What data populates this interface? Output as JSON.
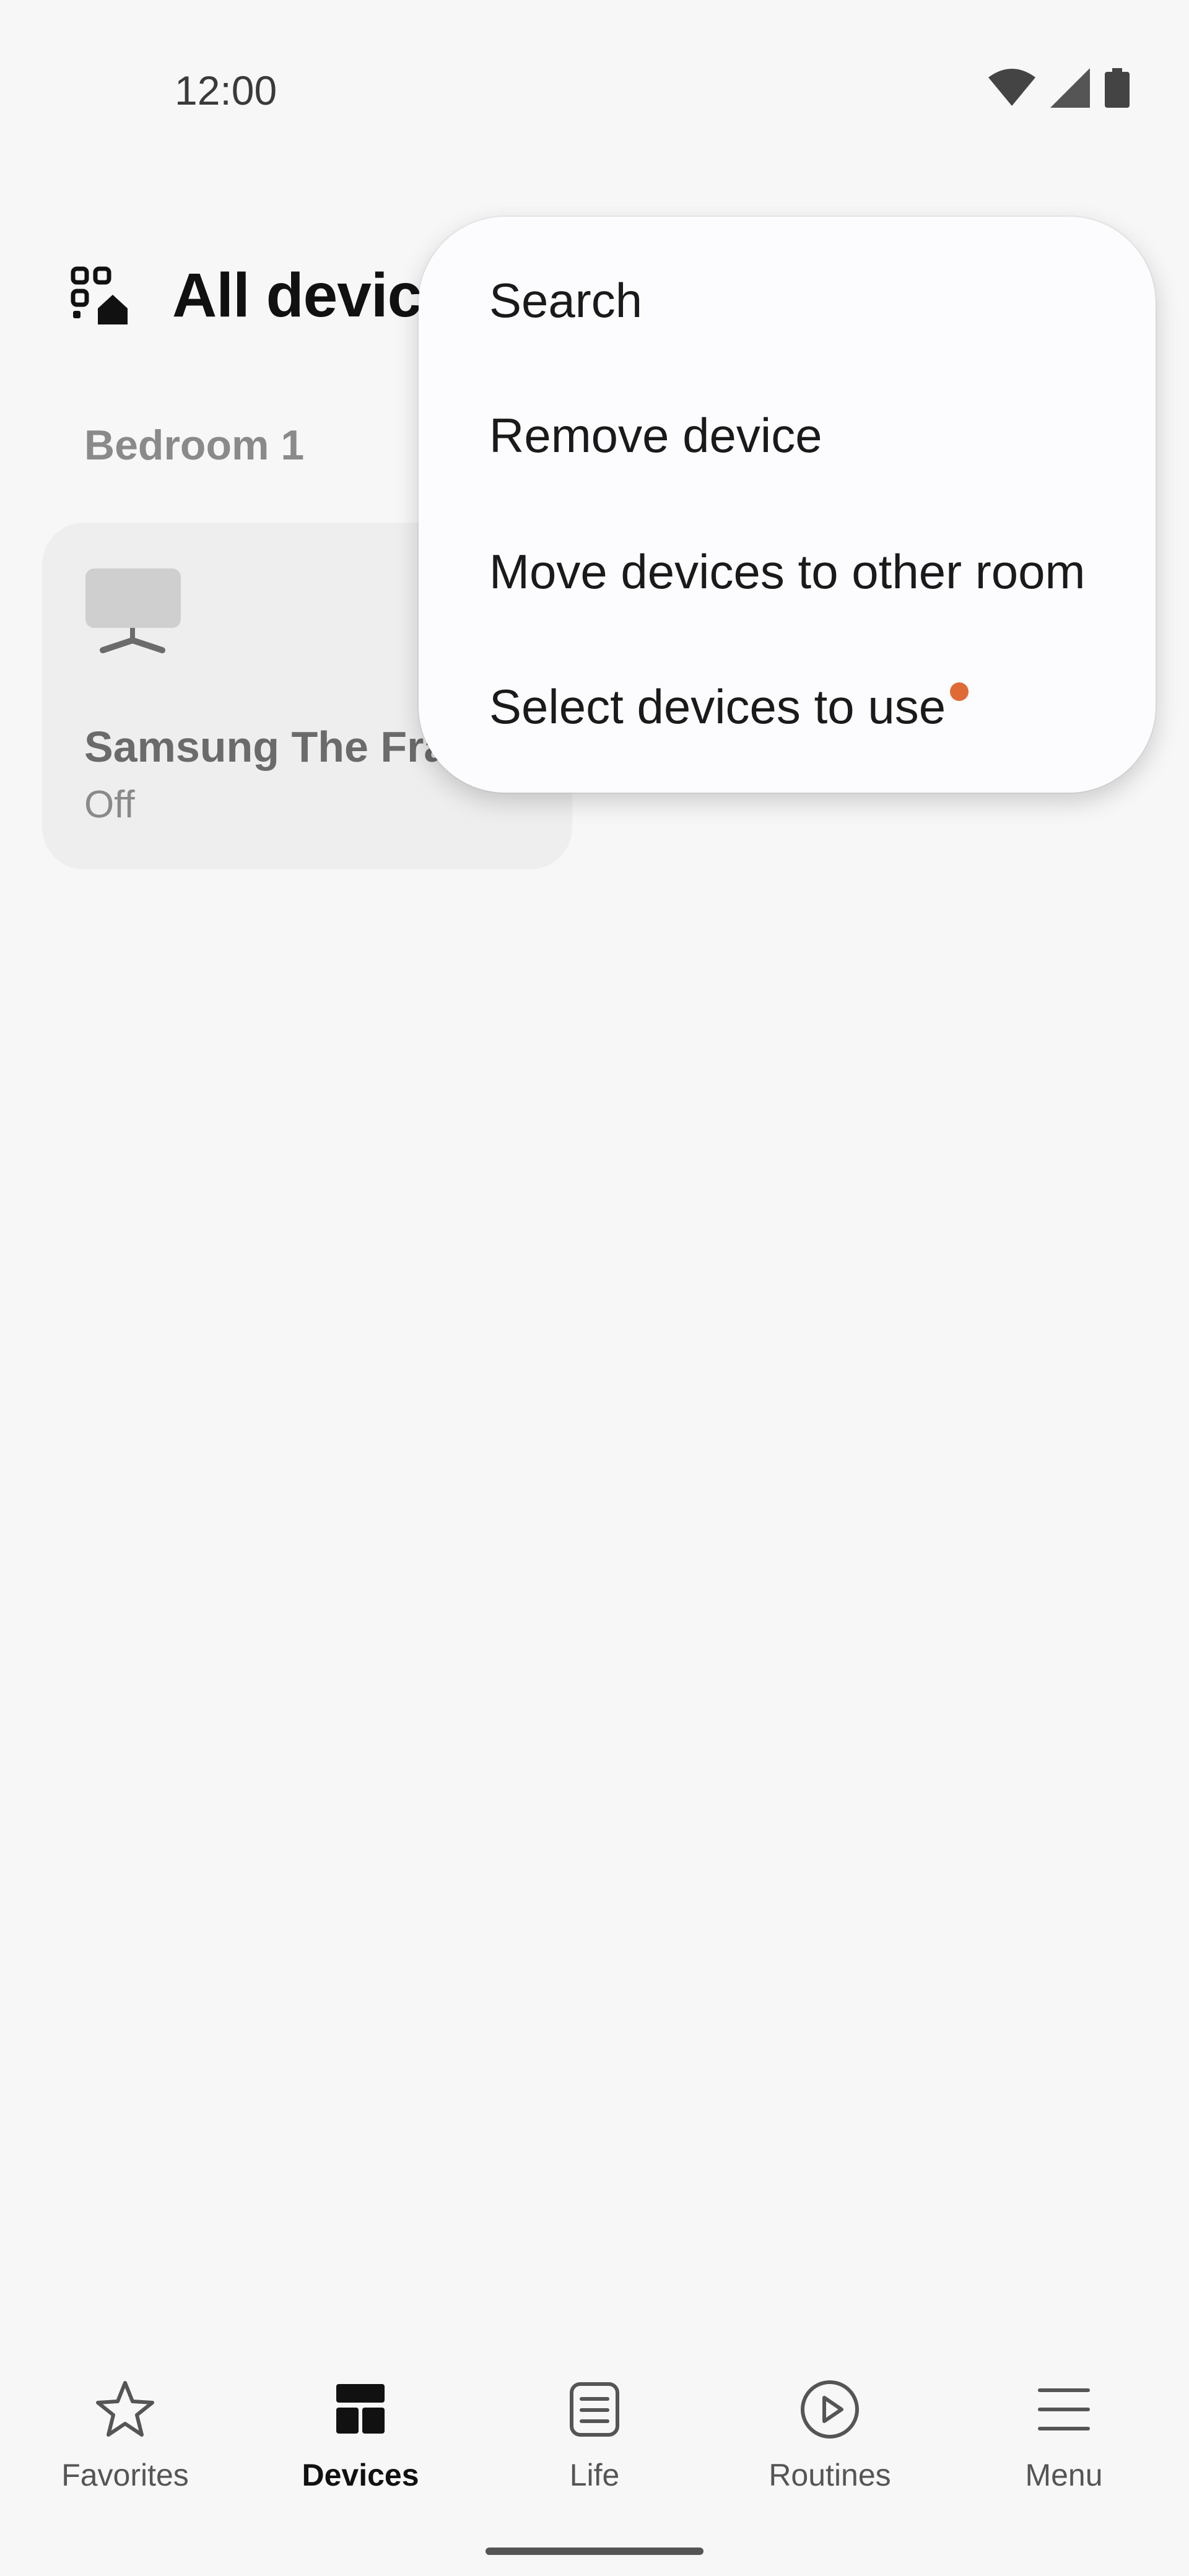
{
  "status_bar": {
    "time": "12:00"
  },
  "header": {
    "title": "All devic",
    "icon": "qr-home-icon"
  },
  "room": {
    "label": "Bedroom 1"
  },
  "device_card": {
    "name": "Samsung The Fra",
    "status": "Off",
    "icon": "tv-icon"
  },
  "overflow_menu": {
    "items": [
      {
        "label": "Search"
      },
      {
        "label": "Remove device"
      },
      {
        "label": "Move devices to other room"
      },
      {
        "label": "Select devices to use"
      }
    ],
    "new_dot_color": "#e06a35"
  },
  "bottom_nav": {
    "items": [
      {
        "label": "Favorites",
        "icon": "star-icon"
      },
      {
        "label": "Devices",
        "icon": "devices-grid-icon",
        "active": true
      },
      {
        "label": "Life",
        "icon": "life-icon"
      },
      {
        "label": "Routines",
        "icon": "play-icon"
      },
      {
        "label": "Menu",
        "icon": "hamburger-icon"
      }
    ]
  }
}
